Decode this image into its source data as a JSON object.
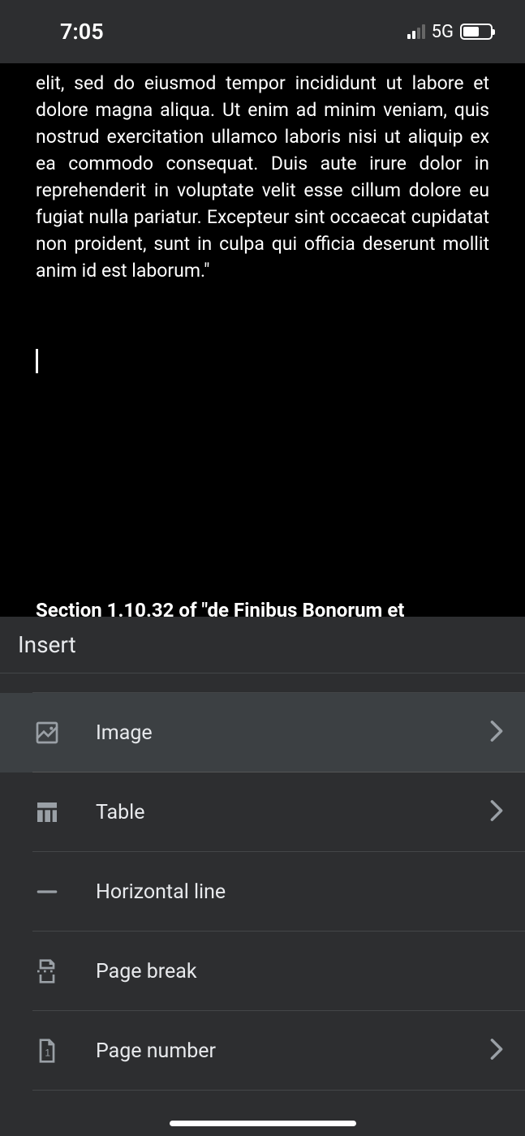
{
  "statusBar": {
    "time": "7:05",
    "networkType": "5G"
  },
  "document": {
    "bodyText": "elit, sed do eiusmod tempor incididunt ut labore et dolore magna aliqua. Ut enim ad minim veniam, quis nostrud exercitation ullamco laboris nisi ut aliquip ex ea commodo consequat. Duis aute irure dolor in reprehenderit in voluptate velit esse cillum dolore eu fugiat nulla pariatur. Excepteur sint occaecat cupidatat non proident, sunt in culpa qui officia deserunt mollit anim id est laborum.\"",
    "nextHeading": "Section 1.10.32 of \"de Finibus Bonorum et"
  },
  "insertPanel": {
    "title": "Insert",
    "items": [
      {
        "label": "Image",
        "icon": "image-icon",
        "hasChevron": true,
        "highlighted": true
      },
      {
        "label": "Table",
        "icon": "table-icon",
        "hasChevron": true,
        "highlighted": false
      },
      {
        "label": "Horizontal line",
        "icon": "horizontal-line-icon",
        "hasChevron": false,
        "highlighted": false
      },
      {
        "label": "Page break",
        "icon": "page-break-icon",
        "hasChevron": false,
        "highlighted": false
      },
      {
        "label": "Page number",
        "icon": "page-number-icon",
        "hasChevron": true,
        "highlighted": false
      }
    ]
  }
}
